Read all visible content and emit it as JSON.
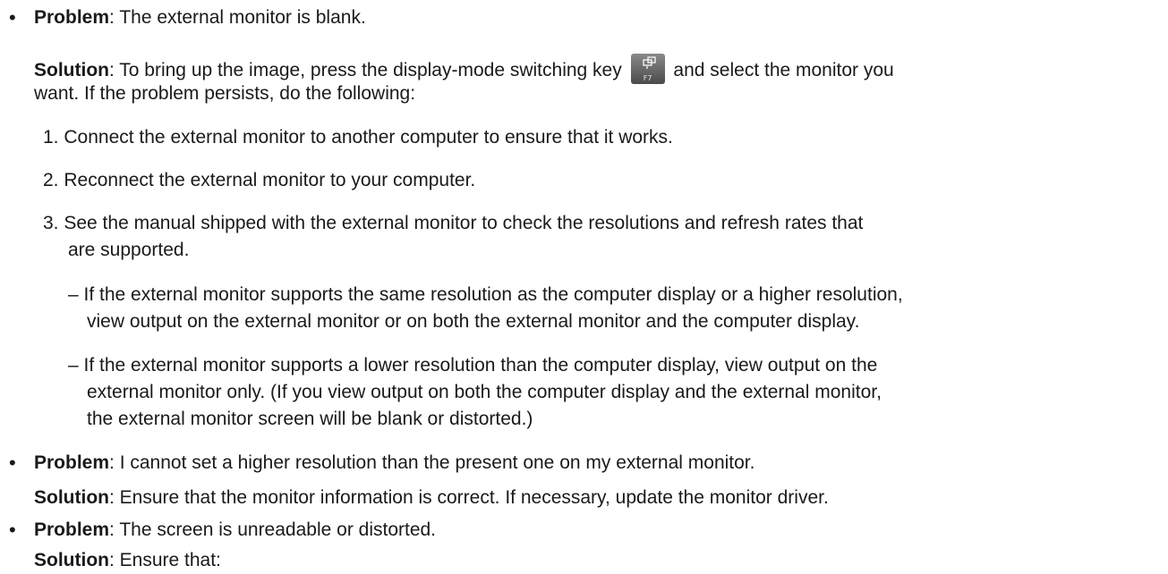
{
  "problems": [
    {
      "problem_label": "Problem",
      "problem_text": ": The external monitor is blank.",
      "solution_label": "Solution",
      "solution_line1_before_key": ": To bring up the image, press the display-mode switching key",
      "key_label": "F7",
      "solution_line1_after_key": "and select the monitor you",
      "solution_line2": "want. If the problem persists, do the following:",
      "steps": [
        {
          "num": "1.",
          "text": "Connect the external monitor to another computer to ensure that it works."
        },
        {
          "num": "2.",
          "text": "Reconnect the external monitor to your computer."
        },
        {
          "num": "3.",
          "text": "See the manual shipped with the external monitor to check the resolutions and refresh rates that",
          "text2": "are supported."
        }
      ],
      "subitems": [
        {
          "dash": "–",
          "line1": "If the external monitor supports the same resolution as the computer display or a higher resolution,",
          "line2": "view output on the external monitor or on both the external monitor and the computer display."
        },
        {
          "dash": "–",
          "line1": "If the external monitor supports a lower resolution than the computer display, view output on the",
          "line2": "external monitor only. (If you view output on both the computer display and the external monitor,",
          "line3": "the external monitor screen will be blank or distorted.)"
        }
      ]
    },
    {
      "problem_label": "Problem",
      "problem_text": ": I cannot set a higher resolution than the present one on my external monitor.",
      "solution_label": "Solution",
      "solution_text": ": Ensure that the monitor information is correct. If necessary, update the monitor driver."
    },
    {
      "problem_label": "Problem",
      "problem_text": ": The screen is unreadable or distorted.",
      "solution_label": "Solution",
      "solution_text": ": Ensure that:"
    }
  ]
}
